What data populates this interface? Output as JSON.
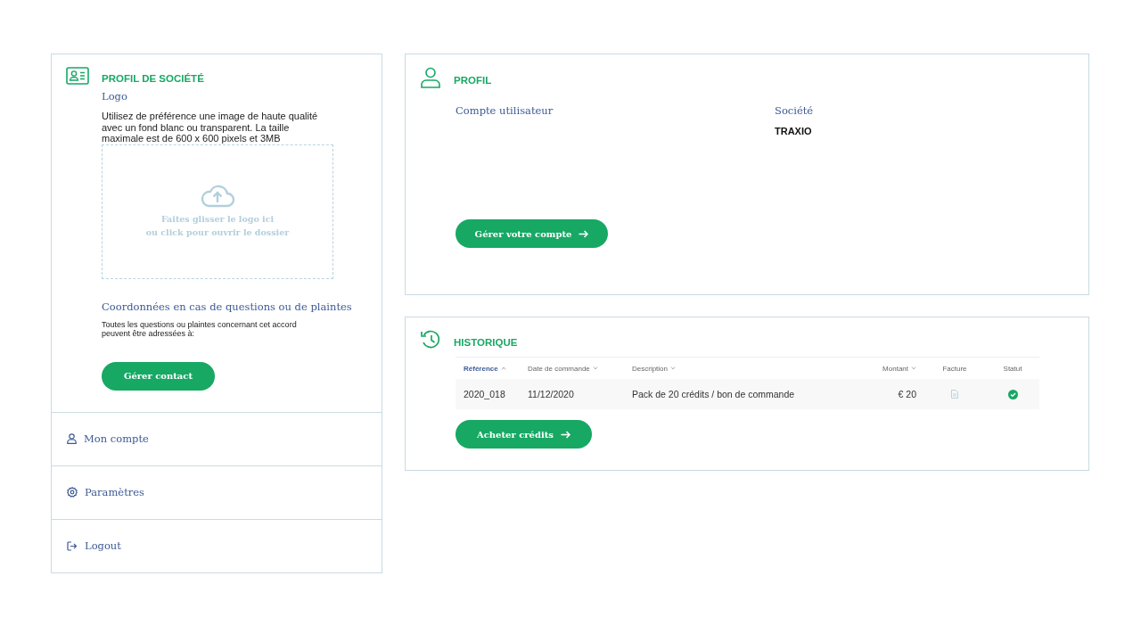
{
  "company_profile": {
    "title": "PROFIL DE SOCIÉTÉ",
    "logo_label": "Logo",
    "logo_help": "Utilisez de préférence une image de haute qualité avec un fond blanc ou transparent. La taille maximale est de 600 x 600 pixels et 3MB",
    "dropzone_lines": [
      "Faites glisser le logo ici",
      "ou click pour ouvrir le dossier"
    ],
    "contact_label": "Coordonnées en cas de questions ou de plaintes",
    "contact_help": "Toutes les questions ou plaintes concernant cet accord peuvent être adressées à:",
    "contact_button": "Gérer contact"
  },
  "sidebar": {
    "items": [
      {
        "label": "Mon compte",
        "kind": "user"
      },
      {
        "label": "Paramètres",
        "kind": "settings"
      },
      {
        "label": "Logout",
        "kind": "logout"
      }
    ]
  },
  "profile": {
    "title": "PROFIL",
    "fields": [
      {
        "label": "Compte utilisateur"
      },
      {
        "label": "Société",
        "value": "TRAXIO"
      }
    ],
    "button": "Gérer votre compte"
  },
  "history": {
    "title": "HISTORIQUE",
    "columns": [
      {
        "label": "Référence",
        "sortable": true,
        "selected": true
      },
      {
        "label": "Date de commande",
        "sortable": true,
        "selected": false
      },
      {
        "label": "Description",
        "sortable": true,
        "selected": false
      },
      {
        "label": "Montant",
        "sortable": true,
        "selected": false
      },
      {
        "label": "Facture",
        "sortable": false,
        "selected": false
      },
      {
        "label": "Statut",
        "sortable": false,
        "selected": false
      }
    ],
    "rows": [
      {
        "reference": "2020_018",
        "date": "11/12/2020",
        "description": "Pack de 20 crédits / bon de commande",
        "amount": "€ 20",
        "invoice": true,
        "paid": true
      }
    ],
    "button": "Acheter crédits"
  }
}
